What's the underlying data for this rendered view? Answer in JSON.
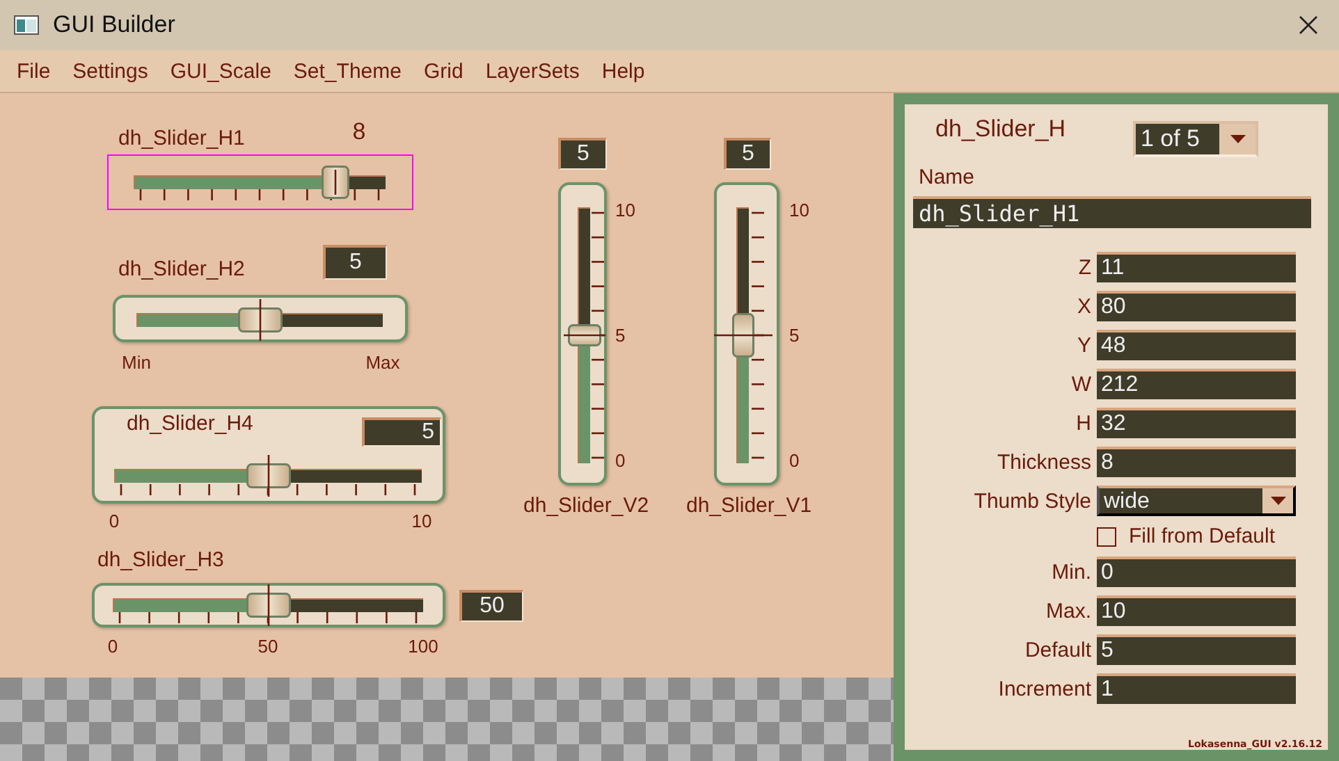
{
  "window": {
    "title": "GUI Builder"
  },
  "menu": [
    "File",
    "Settings",
    "GUI_Scale",
    "Set_Theme",
    "Grid",
    "LayerSets",
    "Help"
  ],
  "sliders": [
    {
      "kind": "horizontal",
      "label": "dh_Slider_H1",
      "value": "8",
      "selected": true,
      "level": 0.8
    },
    {
      "kind": "horizontal",
      "label": "dh_Slider_H2",
      "value": "5",
      "selected": false,
      "level": 0.5,
      "scale": [
        "Min",
        "Max"
      ]
    },
    {
      "kind": "horizontal",
      "label": "dh_Slider_H4",
      "value": "5",
      "selected": false,
      "level": 0.5,
      "scale": [
        "0",
        "10"
      ]
    },
    {
      "kind": "horizontal",
      "label": "dh_Slider_H3",
      "value": "50",
      "selected": false,
      "level": 0.5,
      "scale": [
        "0",
        "50",
        "100"
      ]
    },
    {
      "kind": "vertical",
      "label": "dh_Slider_V2",
      "value": "5",
      "selected": false,
      "level": 0.5,
      "scale": [
        "10",
        "5",
        "0"
      ]
    },
    {
      "kind": "vertical",
      "label": "dh_Slider_V1",
      "value": "5",
      "selected": false,
      "level": 0.5,
      "scale": [
        "10",
        "5",
        "0"
      ]
    }
  ],
  "panel": {
    "title": "dh_Slider_H",
    "selector": "1 of 5",
    "name_label": "Name",
    "name_value": "dh_Slider_H1",
    "fields": [
      {
        "kind": "text",
        "label": "Z",
        "value": "11"
      },
      {
        "kind": "text",
        "label": "X",
        "value": "80"
      },
      {
        "kind": "text",
        "label": "Y",
        "value": "48"
      },
      {
        "kind": "text",
        "label": "W",
        "value": "212"
      },
      {
        "kind": "text",
        "label": "H",
        "value": "32"
      },
      {
        "kind": "text",
        "label": "Thickness",
        "value": "8"
      },
      {
        "kind": "dropdown",
        "label": "Thumb Style",
        "value": "wide"
      },
      {
        "kind": "checkbox",
        "label": "Fill from Default",
        "checked": false
      },
      {
        "kind": "text",
        "label": "Min.",
        "value": "0"
      },
      {
        "kind": "text",
        "label": "Max.",
        "value": "10"
      },
      {
        "kind": "text",
        "label": "Default",
        "value": "5"
      },
      {
        "kind": "text",
        "label": "Increment",
        "value": "1"
      }
    ],
    "version": "Lokasenna_GUI v2.16.12"
  }
}
